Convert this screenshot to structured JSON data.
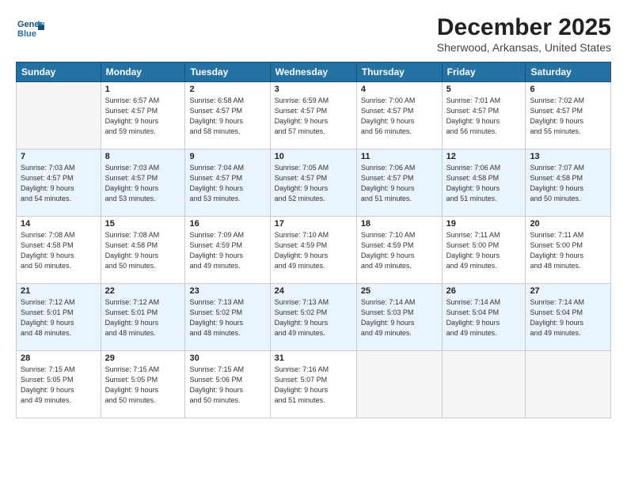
{
  "header": {
    "logo_line1": "General",
    "logo_line2": "Blue",
    "month": "December 2025",
    "location": "Sherwood, Arkansas, United States"
  },
  "weekdays": [
    "Sunday",
    "Monday",
    "Tuesday",
    "Wednesday",
    "Thursday",
    "Friday",
    "Saturday"
  ],
  "weeks": [
    [
      {
        "day": "",
        "info": ""
      },
      {
        "day": "1",
        "info": "Sunrise: 6:57 AM\nSunset: 4:57 PM\nDaylight: 9 hours\nand 59 minutes."
      },
      {
        "day": "2",
        "info": "Sunrise: 6:58 AM\nSunset: 4:57 PM\nDaylight: 9 hours\nand 58 minutes."
      },
      {
        "day": "3",
        "info": "Sunrise: 6:59 AM\nSunset: 4:57 PM\nDaylight: 9 hours\nand 57 minutes."
      },
      {
        "day": "4",
        "info": "Sunrise: 7:00 AM\nSunset: 4:57 PM\nDaylight: 9 hours\nand 56 minutes."
      },
      {
        "day": "5",
        "info": "Sunrise: 7:01 AM\nSunset: 4:57 PM\nDaylight: 9 hours\nand 56 minutes."
      },
      {
        "day": "6",
        "info": "Sunrise: 7:02 AM\nSunset: 4:57 PM\nDaylight: 9 hours\nand 55 minutes."
      }
    ],
    [
      {
        "day": "7",
        "info": "Sunrise: 7:03 AM\nSunset: 4:57 PM\nDaylight: 9 hours\nand 54 minutes."
      },
      {
        "day": "8",
        "info": "Sunrise: 7:03 AM\nSunset: 4:57 PM\nDaylight: 9 hours\nand 53 minutes."
      },
      {
        "day": "9",
        "info": "Sunrise: 7:04 AM\nSunset: 4:57 PM\nDaylight: 9 hours\nand 53 minutes."
      },
      {
        "day": "10",
        "info": "Sunrise: 7:05 AM\nSunset: 4:57 PM\nDaylight: 9 hours\nand 52 minutes."
      },
      {
        "day": "11",
        "info": "Sunrise: 7:06 AM\nSunset: 4:57 PM\nDaylight: 9 hours\nand 51 minutes."
      },
      {
        "day": "12",
        "info": "Sunrise: 7:06 AM\nSunset: 4:58 PM\nDaylight: 9 hours\nand 51 minutes."
      },
      {
        "day": "13",
        "info": "Sunrise: 7:07 AM\nSunset: 4:58 PM\nDaylight: 9 hours\nand 50 minutes."
      }
    ],
    [
      {
        "day": "14",
        "info": "Sunrise: 7:08 AM\nSunset: 4:58 PM\nDaylight: 9 hours\nand 50 minutes."
      },
      {
        "day": "15",
        "info": "Sunrise: 7:08 AM\nSunset: 4:58 PM\nDaylight: 9 hours\nand 50 minutes."
      },
      {
        "day": "16",
        "info": "Sunrise: 7:09 AM\nSunset: 4:59 PM\nDaylight: 9 hours\nand 49 minutes."
      },
      {
        "day": "17",
        "info": "Sunrise: 7:10 AM\nSunset: 4:59 PM\nDaylight: 9 hours\nand 49 minutes."
      },
      {
        "day": "18",
        "info": "Sunrise: 7:10 AM\nSunset: 4:59 PM\nDaylight: 9 hours\nand 49 minutes."
      },
      {
        "day": "19",
        "info": "Sunrise: 7:11 AM\nSunset: 5:00 PM\nDaylight: 9 hours\nand 49 minutes."
      },
      {
        "day": "20",
        "info": "Sunrise: 7:11 AM\nSunset: 5:00 PM\nDaylight: 9 hours\nand 48 minutes."
      }
    ],
    [
      {
        "day": "21",
        "info": "Sunrise: 7:12 AM\nSunset: 5:01 PM\nDaylight: 9 hours\nand 48 minutes."
      },
      {
        "day": "22",
        "info": "Sunrise: 7:12 AM\nSunset: 5:01 PM\nDaylight: 9 hours\nand 48 minutes."
      },
      {
        "day": "23",
        "info": "Sunrise: 7:13 AM\nSunset: 5:02 PM\nDaylight: 9 hours\nand 48 minutes."
      },
      {
        "day": "24",
        "info": "Sunrise: 7:13 AM\nSunset: 5:02 PM\nDaylight: 9 hours\nand 49 minutes."
      },
      {
        "day": "25",
        "info": "Sunrise: 7:14 AM\nSunset: 5:03 PM\nDaylight: 9 hours\nand 49 minutes."
      },
      {
        "day": "26",
        "info": "Sunrise: 7:14 AM\nSunset: 5:04 PM\nDaylight: 9 hours\nand 49 minutes."
      },
      {
        "day": "27",
        "info": "Sunrise: 7:14 AM\nSunset: 5:04 PM\nDaylight: 9 hours\nand 49 minutes."
      }
    ],
    [
      {
        "day": "28",
        "info": "Sunrise: 7:15 AM\nSunset: 5:05 PM\nDaylight: 9 hours\nand 49 minutes."
      },
      {
        "day": "29",
        "info": "Sunrise: 7:15 AM\nSunset: 5:05 PM\nDaylight: 9 hours\nand 50 minutes."
      },
      {
        "day": "30",
        "info": "Sunrise: 7:15 AM\nSunset: 5:06 PM\nDaylight: 9 hours\nand 50 minutes."
      },
      {
        "day": "31",
        "info": "Sunrise: 7:16 AM\nSunset: 5:07 PM\nDaylight: 9 hours\nand 51 minutes."
      },
      {
        "day": "",
        "info": ""
      },
      {
        "day": "",
        "info": ""
      },
      {
        "day": "",
        "info": ""
      }
    ]
  ]
}
